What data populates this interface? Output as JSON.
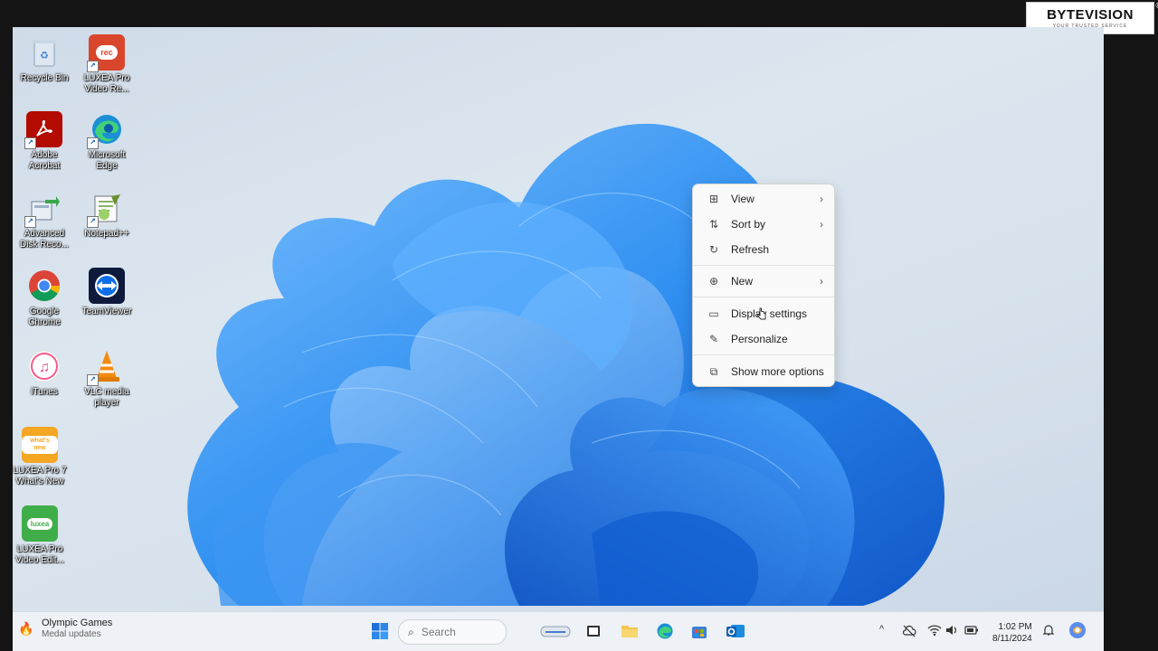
{
  "watermark": {
    "brand": "BYTEVISION",
    "tagline": "YOUR TRUSTED SERVICE",
    "registered": "®"
  },
  "desktop_icons": [
    {
      "label": "Recycle Bin"
    },
    {
      "label": "LUXEA Pro\nVideo Re..."
    },
    {
      "label": "Adobe\nAcrobat"
    },
    {
      "label": "Microsoft\nEdge"
    },
    {
      "label": "Advanced\nDisk Reco..."
    },
    {
      "label": "Notepad++"
    },
    {
      "label": "Google\nChrome"
    },
    {
      "label": "TeamViewer"
    },
    {
      "label": "iTunes"
    },
    {
      "label": "VLC media\nplayer"
    },
    {
      "label": "LUXEA Pro 7\nWhat's New"
    },
    {
      "label": "LUXEA Pro\nVideo Edit..."
    }
  ],
  "icon_glyph_text": {
    "rec": "rec",
    "whats_new": "what's new",
    "luxea": "luxea"
  },
  "context_menu": {
    "items": [
      {
        "label": "View",
        "icon": "grid-icon",
        "submenu": true
      },
      {
        "label": "Sort by",
        "icon": "sort-icon",
        "submenu": true
      },
      {
        "label": "Refresh",
        "icon": "refresh-icon",
        "submenu": false
      },
      {
        "label": "New",
        "icon": "plus-circle-icon",
        "submenu": true
      },
      {
        "label": "Display settings",
        "icon": "display-icon",
        "submenu": false
      },
      {
        "label": "Personalize",
        "icon": "brush-icon",
        "submenu": false
      },
      {
        "label": "Show more options",
        "icon": "open-external-icon",
        "submenu": false
      }
    ],
    "chevron": "›"
  },
  "taskbar": {
    "widget": {
      "title": "Olympic Games",
      "subtitle": "Medal updates"
    },
    "search": {
      "placeholder": "Search"
    },
    "clock": {
      "time": "1:02 PM",
      "date": "8/11/2024"
    },
    "tray_chevron": "^"
  },
  "colors": {
    "accent": "#1f6fd6",
    "taskbar": "#eef1f5",
    "menu_bg": "#f9f9f9"
  }
}
